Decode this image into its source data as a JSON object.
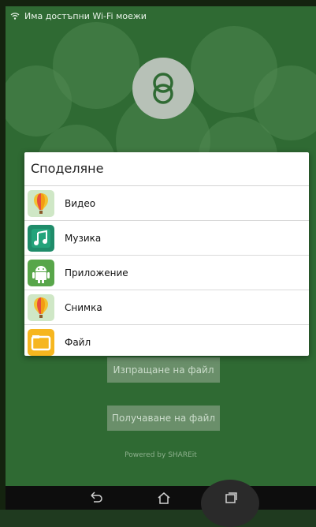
{
  "status_bar": {
    "text": "Има достъпни Wi-Fi моежи",
    "icon": "wifi-icon"
  },
  "app": {
    "logo_icon": "shareit-logo-icon"
  },
  "dialog": {
    "title": "Споделяне",
    "options": [
      {
        "label": "Видео",
        "icon": "balloon-icon"
      },
      {
        "label": "Музика",
        "icon": "music-note-icon"
      },
      {
        "label": "Приложение",
        "icon": "android-icon"
      },
      {
        "label": "Снимка",
        "icon": "balloon-icon"
      },
      {
        "label": "Файл",
        "icon": "folder-icon"
      }
    ]
  },
  "buttons": {
    "send": "Изпращане на файл",
    "receive": "Получаване на файл"
  },
  "footer": {
    "powered_by": "Powered by SHAREit"
  },
  "nav": {
    "back_icon": "back-icon",
    "home_icon": "home-icon",
    "recents_icon": "recent-apps-icon"
  },
  "colors": {
    "background_green": "#2f6a33",
    "button_green": "#6a8f6a"
  }
}
